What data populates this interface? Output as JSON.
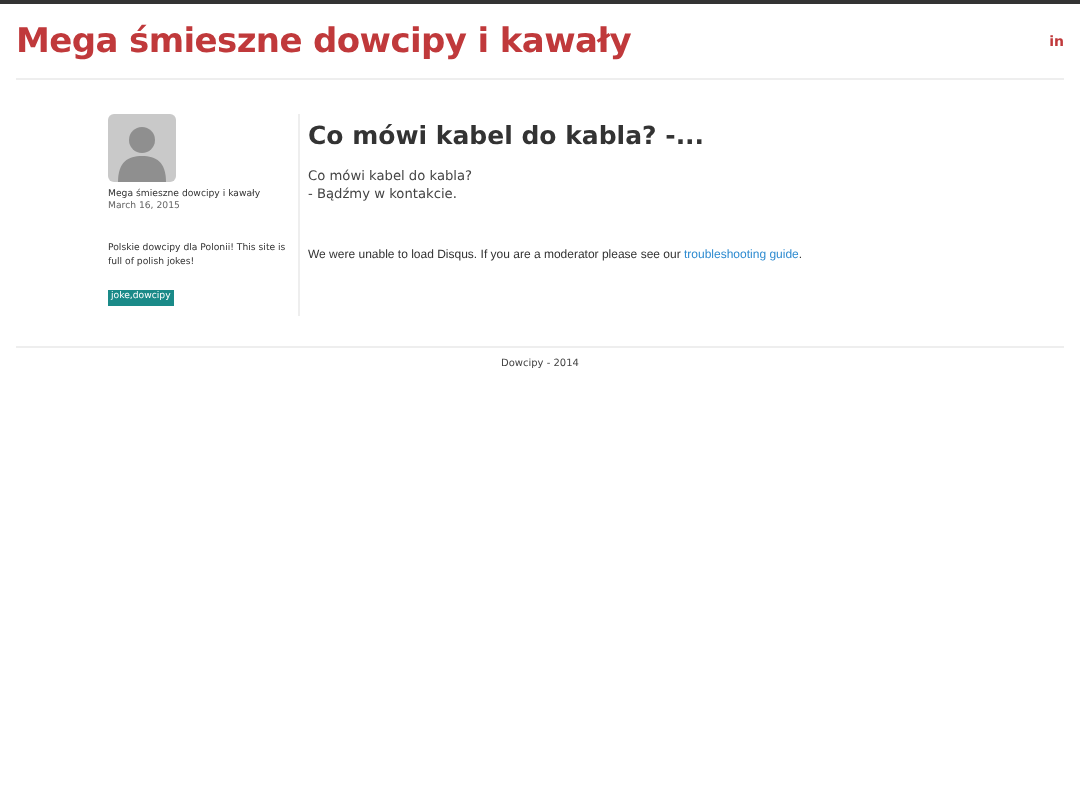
{
  "header": {
    "title": "Mega śmieszne dowcipy i kawały",
    "social_link": "in"
  },
  "sidebar": {
    "author": "Mega śmieszne dowcipy i kawały",
    "date": "March 16, 2015",
    "description": "Polskie dowcipy dla Polonii! This site is full of polish jokes!",
    "tag": "joke,dowcipy"
  },
  "post": {
    "title": "Co mówi kabel do kabla? -...",
    "lines": [
      "Co mówi kabel do kabla?",
      "- Bądźmy w kontakcie."
    ],
    "disqus_text": "We were unable to load Disqus. If you are a moderator please see our ",
    "disqus_link": "troubleshooting guide",
    "disqus_end": "."
  },
  "footer": {
    "text": "Dowcipy - 2014"
  }
}
